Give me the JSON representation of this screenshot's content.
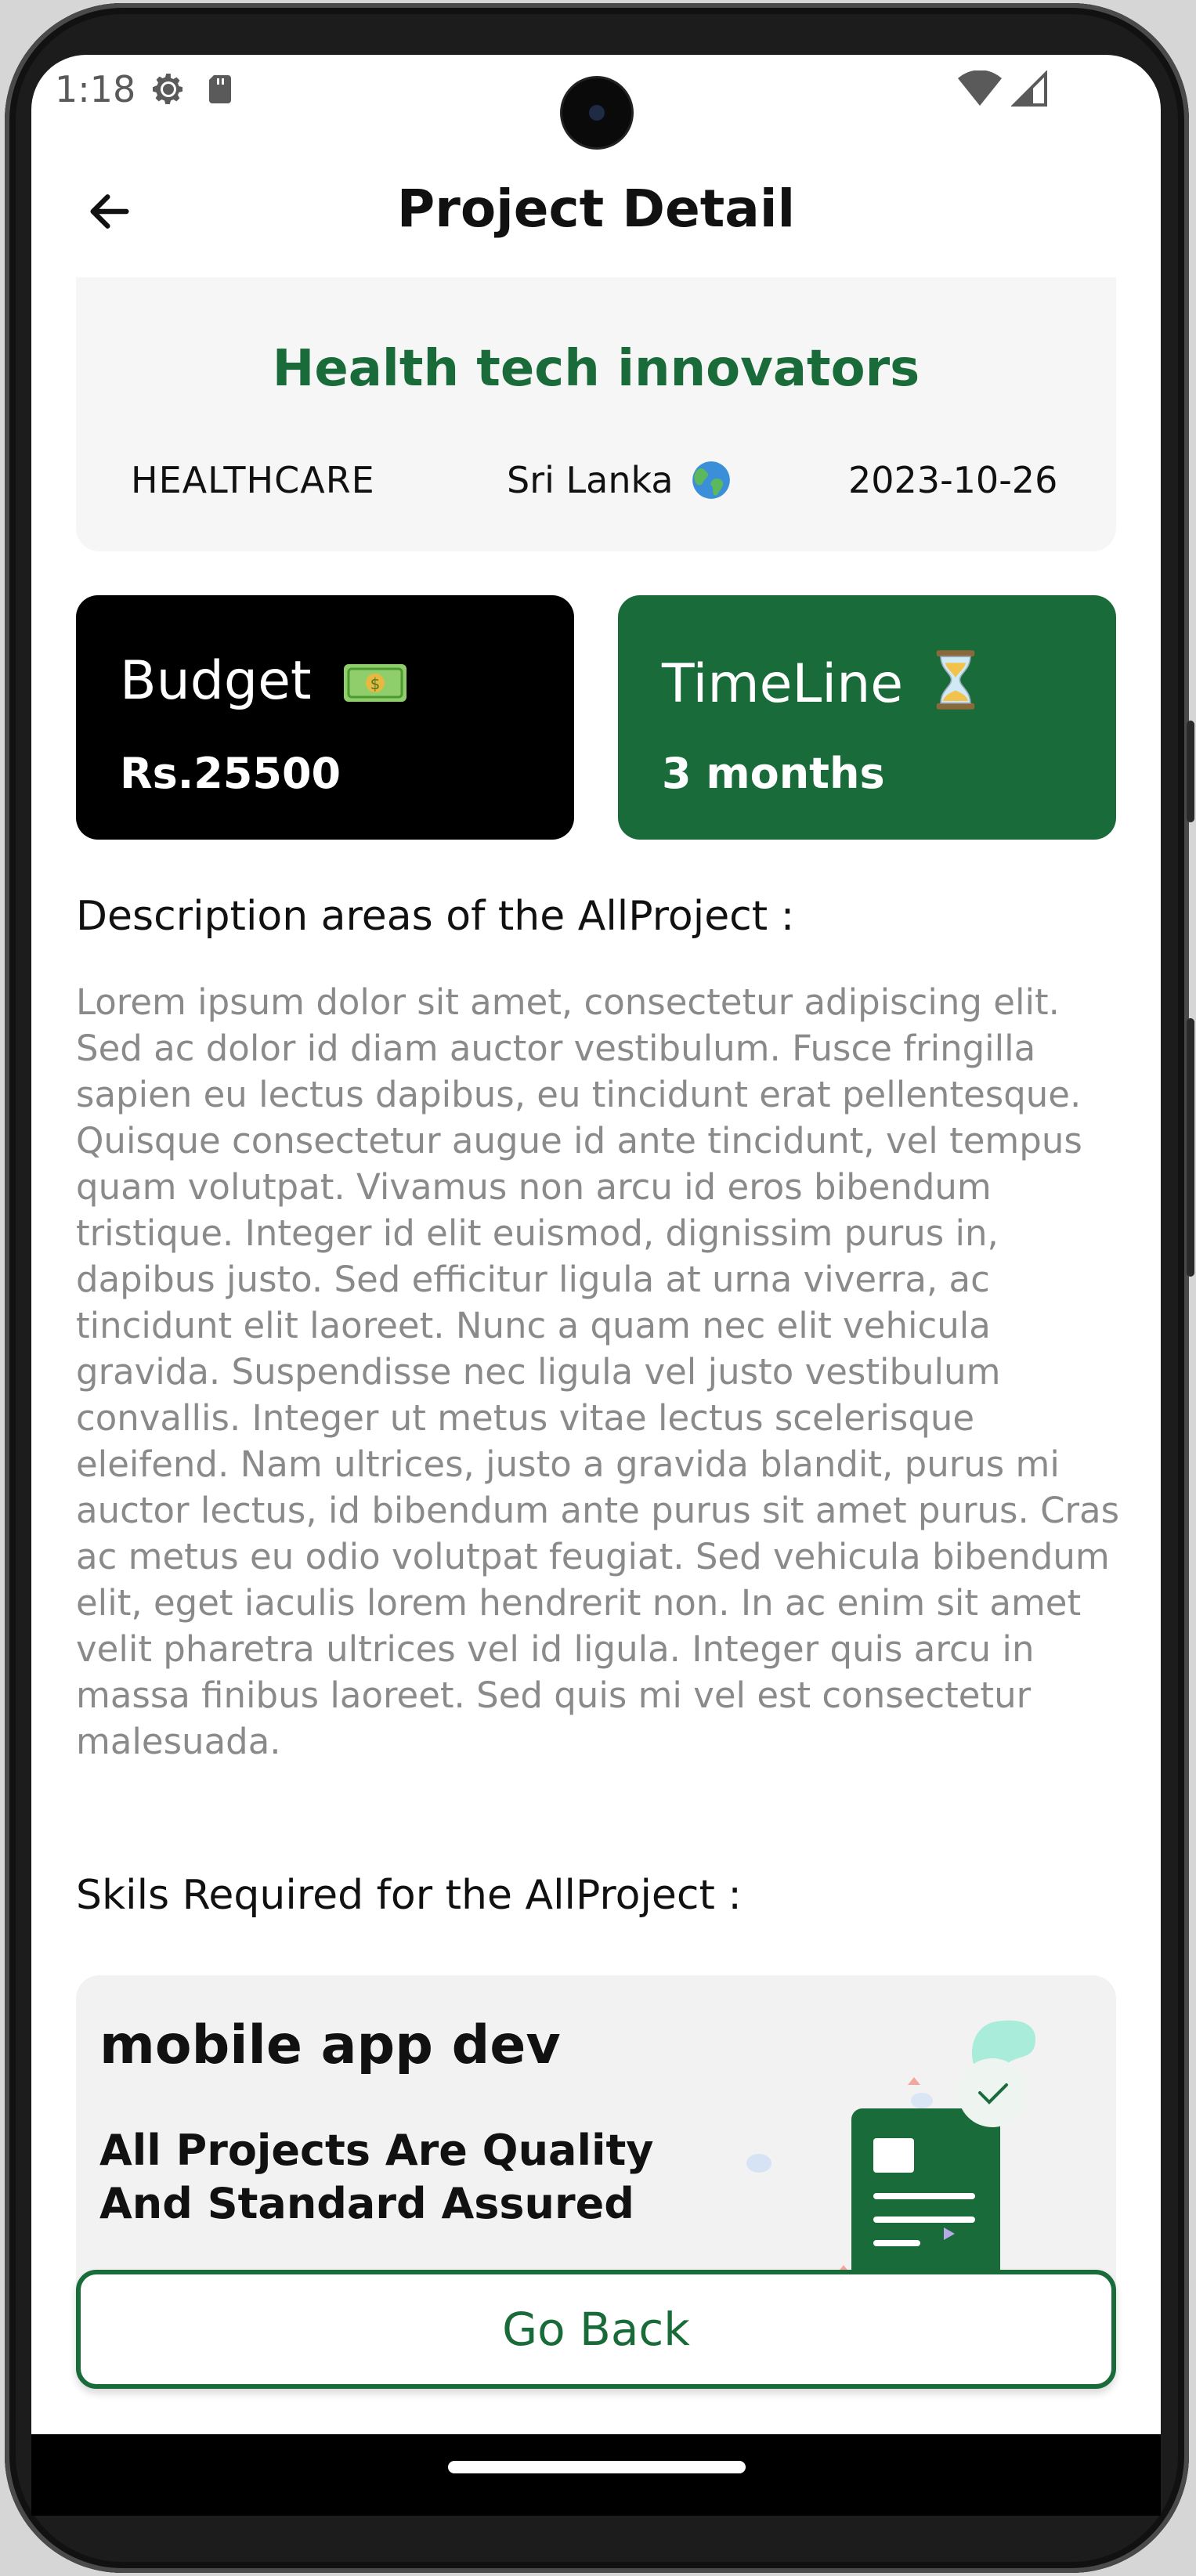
{
  "status_bar": {
    "time": "1:18"
  },
  "app_bar": {
    "title": "Project Detail"
  },
  "project": {
    "name": "Health tech innovators",
    "category": "HEALTHCARE",
    "country": "Sri Lanka",
    "date": "2023-10-26"
  },
  "budget": {
    "label": "Budget",
    "value": "Rs.25500"
  },
  "timeline": {
    "label": "TimeLine",
    "value": "3 months"
  },
  "description": {
    "title": "Description areas of the AllProject :",
    "body": "Lorem ipsum dolor sit amet, consectetur adipiscing elit. Sed ac dolor id diam auctor vestibulum. Fusce fringilla sapien eu lectus dapibus, eu tincidunt erat pellentesque. Quisque consectetur augue id ante tincidunt, vel tempus quam volutpat. Vivamus non arcu id eros bibendum tristique. Integer id elit euismod, dignissim purus in, dapibus justo. Sed efficitur ligula at urna viverra, ac tincidunt elit laoreet. Nunc a quam nec elit vehicula gravida. Suspendisse nec ligula vel justo vestibulum convallis. Integer ut metus vitae lectus scelerisque eleifend. Nam ultrices, justo a gravida blandit, purus mi auctor lectus, id bibendum ante purus sit amet purus. Cras ac metus eu odio volutpat feugiat. Sed vehicula bibendum elit, eget iaculis lorem hendrerit non. In ac enim sit amet velit pharetra ultrices vel id ligula. Integer quis arcu in massa finibus laoreet. Sed quis mi vel est consectetur malesuada."
  },
  "skills": {
    "title": "Skils Required for the AllProject :",
    "items": [
      {
        "name": "mobile app dev",
        "note": "All Projects Are Quality And Standard Assured"
      }
    ]
  },
  "actions": {
    "go_back_label": "Go Back"
  },
  "icons": {
    "back": "arrow-left-icon",
    "settings": "gear-icon",
    "sd_card": "sd-card-icon",
    "wifi": "wifi-icon",
    "signal": "signal-icon",
    "globe": "globe-icon",
    "money": "banknote-icon",
    "hourglass": "hourglass-icon"
  },
  "colors": {
    "brand_green": "#1a6b3a",
    "budget_card": "#000000",
    "header_card": "#f6f6f6",
    "body_text": "#8a8a8a"
  }
}
